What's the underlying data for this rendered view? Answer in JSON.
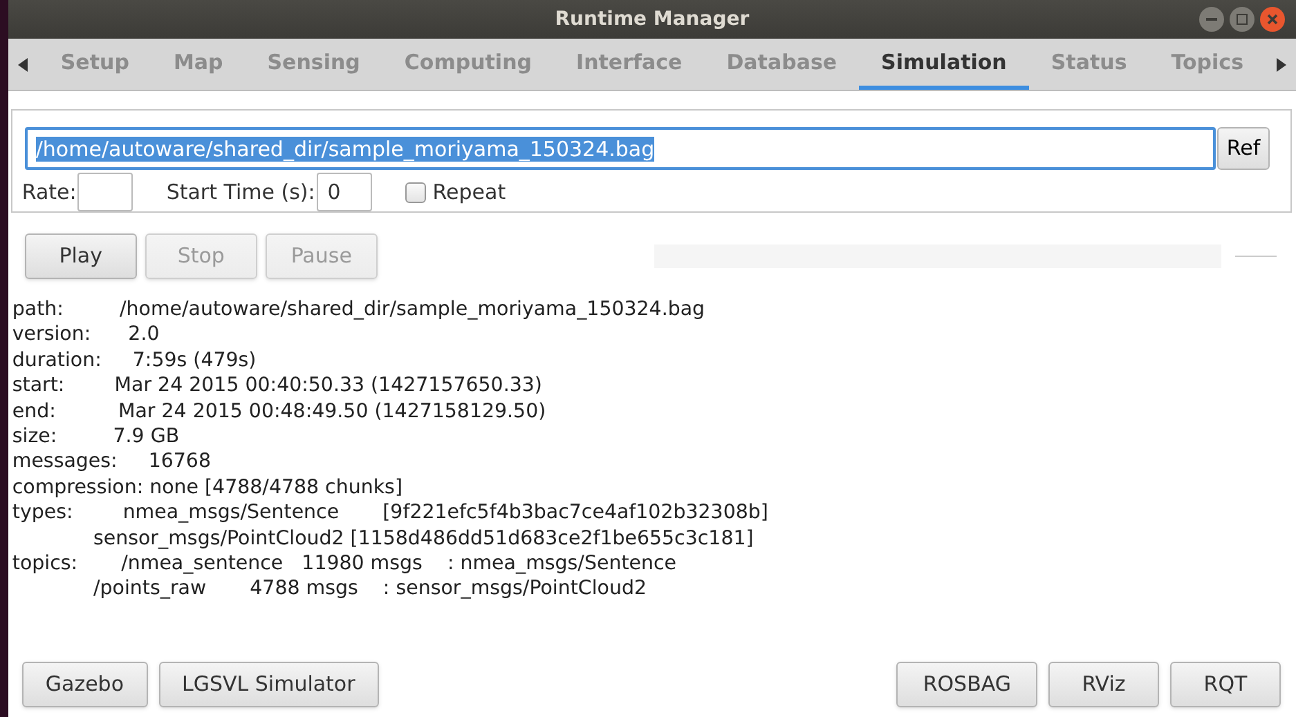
{
  "window": {
    "title": "Runtime Manager"
  },
  "tabs": [
    {
      "label": "Setup",
      "selected": false
    },
    {
      "label": "Map",
      "selected": false
    },
    {
      "label": "Sensing",
      "selected": false
    },
    {
      "label": "Computing",
      "selected": false
    },
    {
      "label": "Interface",
      "selected": false
    },
    {
      "label": "Database",
      "selected": false
    },
    {
      "label": "Simulation",
      "selected": true
    },
    {
      "label": "Status",
      "selected": false
    },
    {
      "label": "Topics",
      "selected": false
    }
  ],
  "bag_file": {
    "value": "/home/autoware/shared_dir/sample_moriyama_150324.bag",
    "button": "Ref"
  },
  "rate": {
    "label": "Rate:"
  },
  "start_time": {
    "label": "Start Time (s):",
    "value": "0"
  },
  "repeat": {
    "label": "Repeat",
    "checked": false
  },
  "playback_buttons": [
    {
      "label": "Play",
      "disabled": false
    },
    {
      "label": "Stop",
      "disabled": true
    },
    {
      "label": "Pause",
      "disabled": true
    }
  ],
  "info_lines": [
    "path:         /home/autoware/shared_dir/sample_moriyama_150324.bag",
    "version:      2.0",
    "duration:     7:59s (479s)",
    "start:        Mar 24 2015 00:40:50.33 (1427157650.33)",
    "end:          Mar 24 2015 00:48:49.50 (1427158129.50)",
    "size:         7.9 GB",
    "messages:     16768",
    "compression: none [4788/4788 chunks]",
    "types:        nmea_msgs/Sentence       [9f221efc5f4b3bac7ce4af102b32308b]",
    "             sensor_msgs/PointCloud2 [1158d486dd51d683ce2f1be655c3c181]",
    "topics:       /nmea_sentence   11980 msgs    : nmea_msgs/Sentence",
    "             /points_raw       4788 msgs    : sensor_msgs/PointCloud2"
  ],
  "left_buttons": [
    "Gazebo",
    "LGSVL Simulator"
  ],
  "right_buttons": [
    "ROSBAG",
    "RViz",
    "RQT"
  ]
}
